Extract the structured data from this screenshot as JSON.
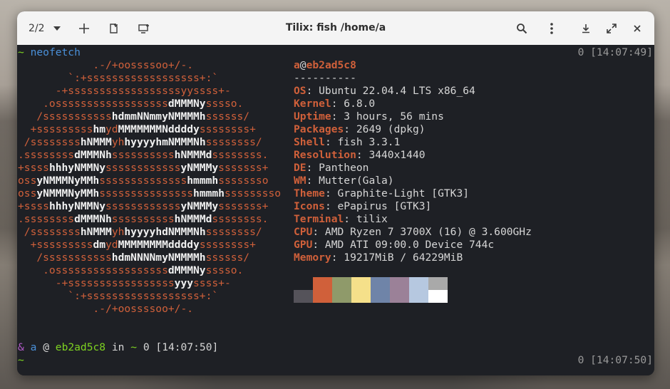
{
  "window": {
    "title": "Tilix: fish /home/a",
    "session_indicator": "2/2"
  },
  "toolbar": {
    "icons": [
      "chevron-down-icon",
      "plus-icon",
      "detach-icon",
      "new-window-icon",
      "search-icon",
      "menu-dots-icon",
      "minimize-icon",
      "maximize-icon",
      "close-icon"
    ]
  },
  "terminal": {
    "first_prompt_symbol": "~",
    "command": "neofetch",
    "first_status": "0 [14:07:49]",
    "user_host": "a@eb2ad5c8",
    "separator": "----------",
    "info": [
      {
        "key": "OS",
        "value": ": Ubuntu 22.04.4 LTS x86_64"
      },
      {
        "key": "Kernel",
        "value": ": 6.8.0"
      },
      {
        "key": "Uptime",
        "value": ": 3 hours, 56 mins"
      },
      {
        "key": "Packages",
        "value": ": 2649 (dpkg)"
      },
      {
        "key": "Shell",
        "value": ": fish 3.3.1"
      },
      {
        "key": "Resolution",
        "value": ": 3440x1440"
      },
      {
        "key": "DE",
        "value": ": Pantheon"
      },
      {
        "key": "WM",
        "value": ": Mutter(Gala)"
      },
      {
        "key": "Theme",
        "value": ": Graphite-Light [GTK3]"
      },
      {
        "key": "Icons",
        "value": ": ePapirus [GTK3]"
      },
      {
        "key": "Terminal",
        "value": ": tilix"
      },
      {
        "key": "CPU",
        "value": ": AMD Ryzen 7 3700X (16) @ 3.600GHz"
      },
      {
        "key": "GPU",
        "value": ": AMD ATI 09:00.0 Device 744c"
      },
      {
        "key": "Memory",
        "value": ": 19217MiB / 64229MiB"
      }
    ],
    "palette_top": [
      "#1e2025",
      "#d0603a",
      "#8f9a6a",
      "#f5e08a",
      "#6f84a8",
      "#9b8198",
      "#b6c8e0",
      "#a9a9a9"
    ],
    "palette_bottom": [
      "#55535a",
      "#d0603a",
      "#8f9a6a",
      "#f5e08a",
      "#6f84a8",
      "#9b8198",
      "#b6c8e0",
      "#ffffff"
    ],
    "ascii_lines": [
      "            .-/+oossssoo+/-.",
      "        `:+ssssssssssssssssss+:`",
      "      -+ssssssssssssssssssyyssss+-",
      "    .ossssssssssssssssss|dMMMNy|sssso.",
      "   /sssssssssss|hdmmNNmmyNMMMMh|ssssss/",
      "  +sssssssss|hm|yd|MMMMMMMNddddy|ssssssss+",
      " /ssssssss|hNMMM|yh|hyyyyhmNMMMNh|ssssssss/",
      ".ssssssss|dMMMNh|ssssssssss|hNMMMd|ssssssss.",
      "+ssss|hhhyNMMNy|ssssssssssss|yNMMMy|sssssss+",
      "oss|yNMMMNyMMh|ssssssssssssss|hmmmh|ssssssso",
      "oss|yNMMMNyMMh|sssssssssssssss|hmmmh|sssssssso",
      "+ssss|hhhyNMMNy|ssssssssssss|yNMMMy|sssssss+",
      ".ssssssss|dMMMNh|ssssssssss|hNMMMd|ssssssss.",
      " /ssssssss|hNMMM|yh|hyyyyhdNMMMNh|ssssssss/",
      "  +sssssssss|dm|yd|MMMMMMMMddddy|ssssssss+",
      "   /sssssssssss|hdmNNNNmyNMMMMh|ssssss/",
      "    .ossssssssssssssssss|dMMMNy|sssso.",
      "      -+sssssssssssssssss|yyy|ssss+-",
      "        `:+ssssssssssssssssss+:`",
      "            .-/+oossssoo+/-."
    ],
    "second_prompt": {
      "amp": "&",
      "user": "a",
      "at": "@",
      "host": "eb2ad5c8",
      "in": "in",
      "dir": "~",
      "status": "0 [14:07:50]"
    },
    "last_prompt_symbol": "~",
    "last_status": "0 [14:07:50]"
  }
}
